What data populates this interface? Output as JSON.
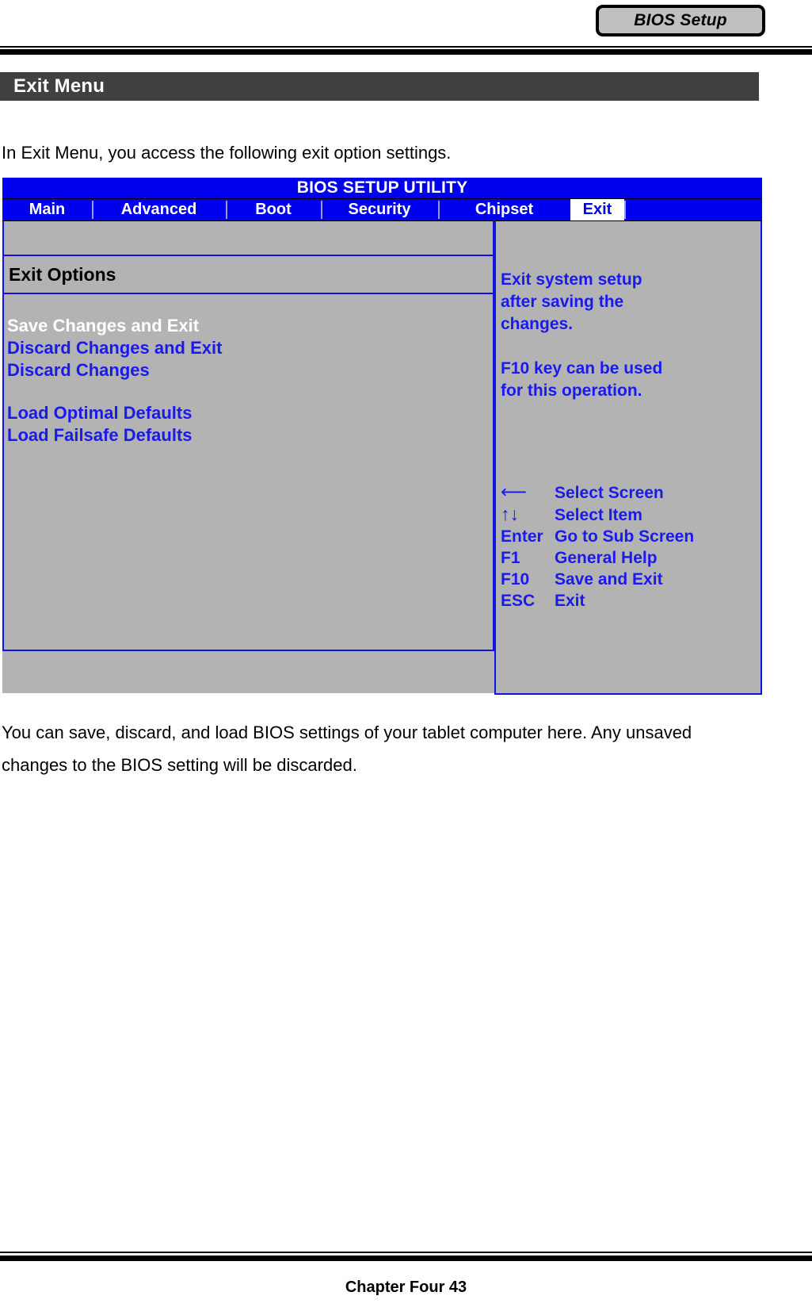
{
  "header": {
    "chip_label": "BIOS Setup"
  },
  "section": {
    "title": "Exit Menu"
  },
  "intro": {
    "text": "In Exit Menu, you access the following exit option settings."
  },
  "bios": {
    "title": "BIOS SETUP UTILITY",
    "tabs": [
      {
        "label": "Main",
        "active": false
      },
      {
        "label": "Advanced",
        "active": false
      },
      {
        "label": "Boot",
        "active": false
      },
      {
        "label": "Security",
        "active": false
      },
      {
        "label": "Chipset",
        "active": false
      },
      {
        "label": "Exit",
        "active": true
      }
    ],
    "group_title": "Exit Options",
    "options": [
      {
        "label": "Save Changes and Exit",
        "selected": true
      },
      {
        "label": "Discard Changes and Exit",
        "selected": false
      },
      {
        "label": "Discard Changes",
        "selected": false
      },
      {
        "label": "Load Optimal Defaults",
        "selected": false
      },
      {
        "label": "Load Failsafe Defaults",
        "selected": false
      }
    ],
    "help": {
      "line1": "Exit system setup",
      "line2": "after saving the",
      "line3": "changes.",
      "line4": "F10 key can be used",
      "line5": "for this operation."
    },
    "key_legend": [
      {
        "key": "⟵",
        "desc": "Select Screen"
      },
      {
        "key": "↑↓",
        "desc": "Select Item"
      },
      {
        "key": "Enter",
        "desc": "Go to Sub Screen"
      },
      {
        "key": "F1",
        "desc": "General Help"
      },
      {
        "key": "F10",
        "desc": "Save and Exit"
      },
      {
        "key": "ESC",
        "desc": "Exit"
      }
    ],
    "colors": {
      "title_bar": "#0000f0",
      "panel_bg": "#b3b3b3",
      "text_blue": "#1a1aee",
      "selected_text": "#ffffff",
      "border_blue": "#1111e0"
    }
  },
  "body": {
    "line1": "You can save, discard, and load BIOS settings of your tablet computer here. Any unsaved",
    "line2": "changes to the BIOS setting will be discarded."
  },
  "footer": {
    "text": "Chapter Four 43"
  }
}
